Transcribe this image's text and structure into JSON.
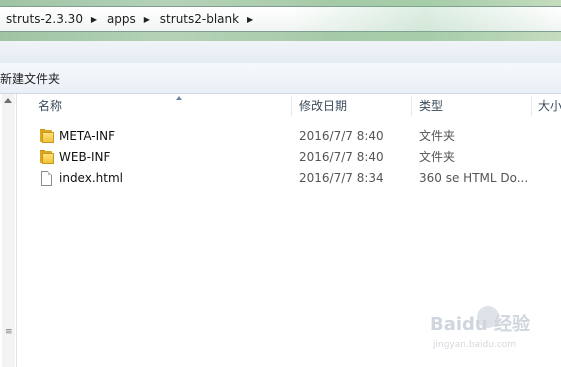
{
  "breadcrumb": {
    "items": [
      "struts-2.3.30",
      "apps",
      "struts2-blank"
    ],
    "separator": "▶"
  },
  "command_bar": {
    "new_folder_label": "新建文件夹"
  },
  "columns": {
    "name": "名称",
    "date_modified": "修改日期",
    "type": "类型",
    "size": "大小"
  },
  "files": [
    {
      "name": "META-INF",
      "date": "2016/7/7 8:40",
      "type": "文件夹",
      "icon": "folder-icon"
    },
    {
      "name": "WEB-INF",
      "date": "2016/7/7 8:40",
      "type": "文件夹",
      "icon": "folder-icon"
    },
    {
      "name": "index.html",
      "date": "2016/7/7 8:34",
      "type": "360 se HTML Do...",
      "icon": "html-file-icon"
    }
  ],
  "scrollbar": {
    "grip": "≡"
  },
  "watermark": {
    "main": "Baidu 经验",
    "sub": "jingyan.baidu.com"
  }
}
